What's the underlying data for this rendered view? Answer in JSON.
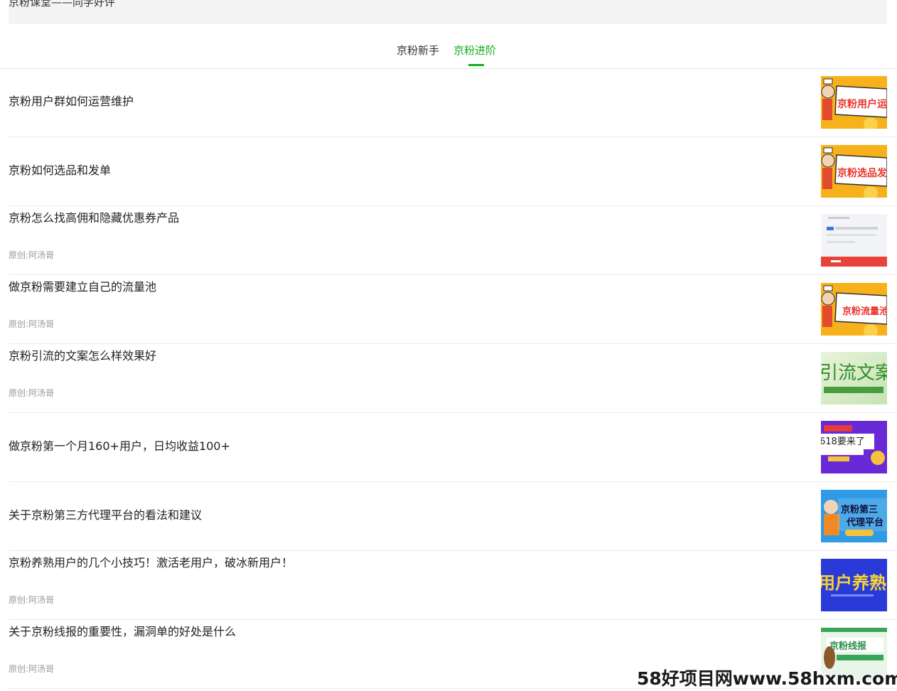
{
  "header": {
    "title": "京粉课堂——同学好评"
  },
  "tabs": [
    {
      "label": "京粉新手",
      "active": false
    },
    {
      "label": "京粉进阶",
      "active": true
    }
  ],
  "accent_color": "#13b01d",
  "articles": [
    {
      "title": "京粉用户群如何运营维护",
      "author": "",
      "thumb_text": "京粉用户运"
    },
    {
      "title": "京粉如何选品和发单",
      "author": "",
      "thumb_text": "京粉选品发"
    },
    {
      "title": "京粉怎么找高佣和隐藏优惠券产品",
      "author": "原创:阿汤哥",
      "thumb_text": ""
    },
    {
      "title": "做京粉需要建立自己的流量池",
      "author": "原创:阿汤哥",
      "thumb_text": "京粉流量池"
    },
    {
      "title": "京粉引流的文案怎么样效果好",
      "author": "原创:阿汤哥",
      "thumb_text": "引流文案"
    },
    {
      "title": "做京粉第一个月160+用户，日均收益100+",
      "author": "",
      "thumb_text": "618要来了"
    },
    {
      "title": "关于京粉第三方代理平台的看法和建议",
      "author": "",
      "thumb_text": "京粉第三代理平台"
    },
    {
      "title": "京粉养熟用户的几个小技巧！激活老用户，破冰新用户！",
      "author": "原创:阿汤哥",
      "thumb_text": "用户养熟"
    },
    {
      "title": "关于京粉线报的重要性，漏洞单的好处是什么",
      "author": "原创:阿汤哥",
      "thumb_text": "京粉线报"
    }
  ],
  "watermark": "58好项目网www.58hxm.com"
}
